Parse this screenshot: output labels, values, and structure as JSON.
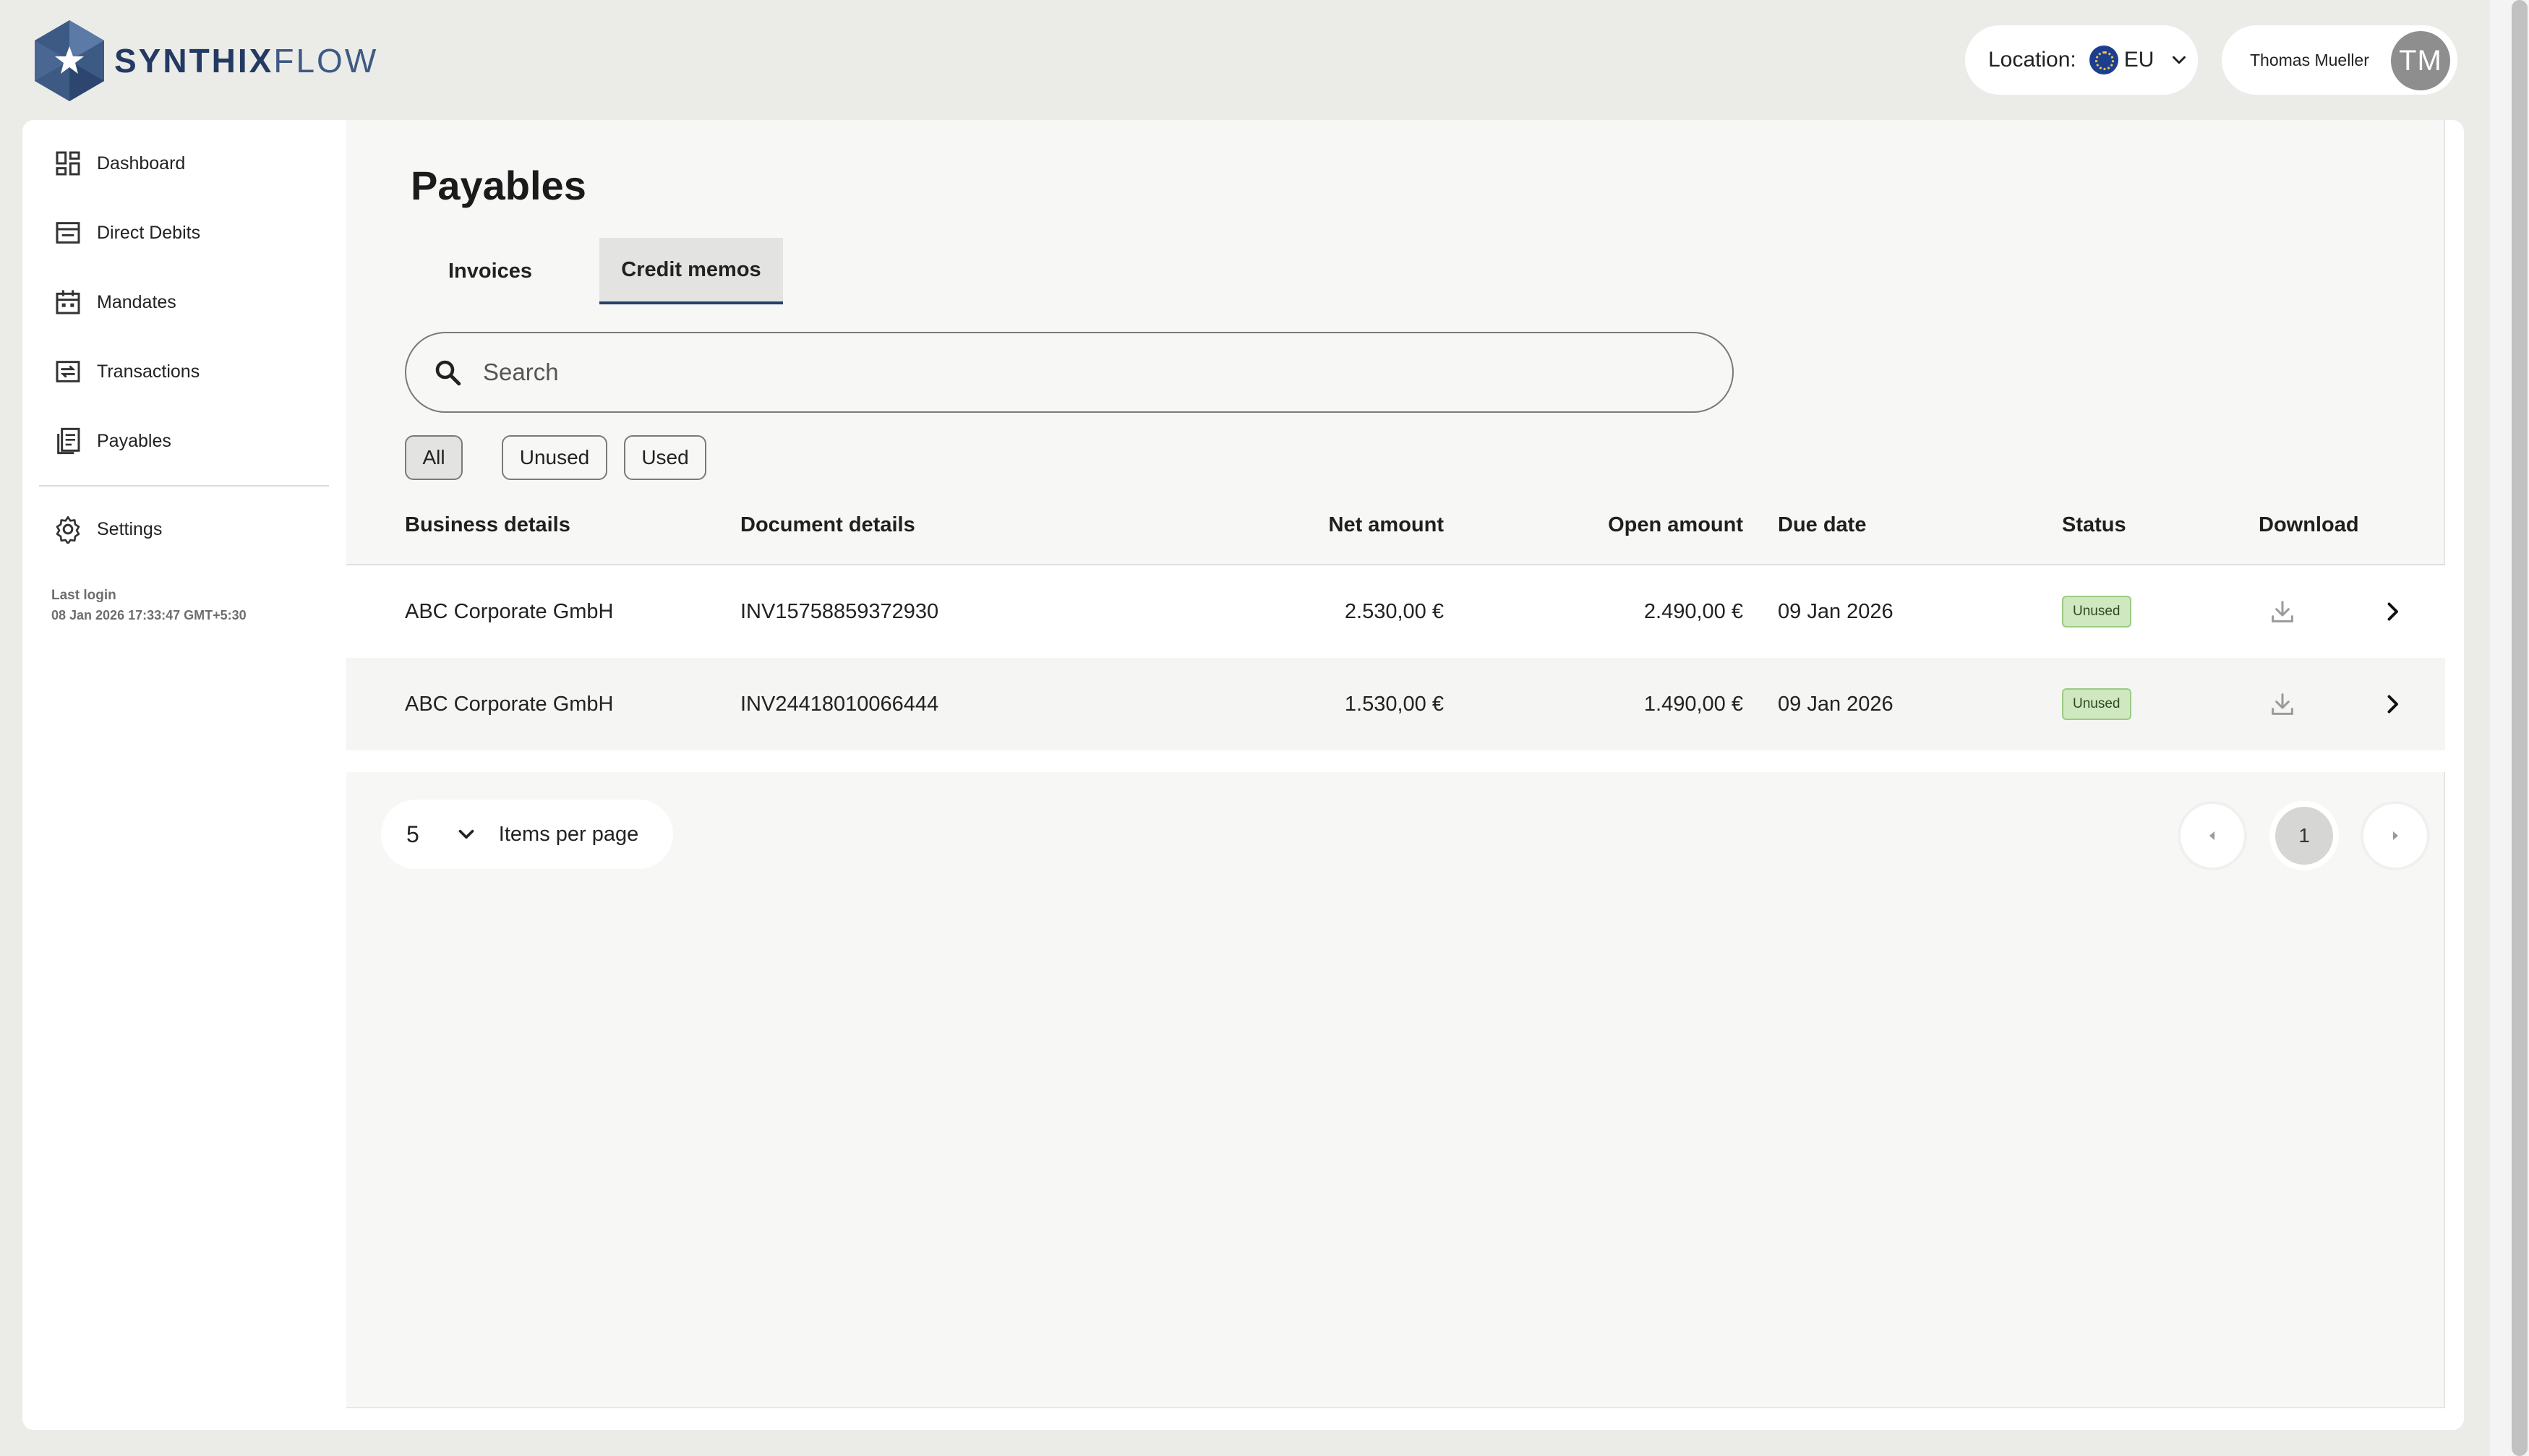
{
  "brand": {
    "name_bold": "SYNTHIX",
    "name_light": "FLOW"
  },
  "header": {
    "location_label": "Location:",
    "location_value": "EU",
    "user_name": "Thomas Mueller",
    "user_initials": "TM"
  },
  "sidebar": {
    "items": [
      {
        "label": "Dashboard",
        "icon": "dashboard-icon"
      },
      {
        "label": "Direct Debits",
        "icon": "direct-debits-icon"
      },
      {
        "label": "Mandates",
        "icon": "calendar-icon"
      },
      {
        "label": "Transactions",
        "icon": "transactions-icon"
      },
      {
        "label": "Payables",
        "icon": "payables-icon"
      }
    ],
    "settings_label": "Settings",
    "last_login_label": "Last login",
    "last_login_value": "08 Jan 2026 17:33:47 GMT+5:30"
  },
  "main": {
    "title": "Payables",
    "tabs": [
      {
        "label": "Invoices",
        "active": false
      },
      {
        "label": "Credit memos",
        "active": true
      }
    ],
    "search": {
      "placeholder": "Search",
      "value": ""
    },
    "filters": [
      {
        "label": "All",
        "active": true
      },
      {
        "label": "Unused",
        "active": false
      },
      {
        "label": "Used",
        "active": false
      }
    ],
    "table": {
      "headers": {
        "business": "Business details",
        "document": "Document details",
        "net": "Net amount",
        "open": "Open amount",
        "due": "Due date",
        "status": "Status",
        "download": "Download"
      },
      "rows": [
        {
          "business": "ABC Corporate GmbH",
          "document": "INV15758859372930",
          "net": "2.530,00 €",
          "open": "2.490,00 €",
          "due": "09 Jan 2026",
          "status": "Unused"
        },
        {
          "business": "ABC Corporate GmbH",
          "document": "INV24418010066444",
          "net": "1.530,00 €",
          "open": "1.490,00 €",
          "due": "09 Jan 2026",
          "status": "Unused"
        }
      ]
    },
    "pagination": {
      "items_per_page": "5",
      "items_per_page_label": "Items per page",
      "current_page": "1"
    }
  },
  "colors": {
    "brand_navy": "#233a62",
    "active_tab_underline": "#23406a",
    "status_unused_bg": "#cfe8c0",
    "page_bg": "#ebebe8"
  }
}
